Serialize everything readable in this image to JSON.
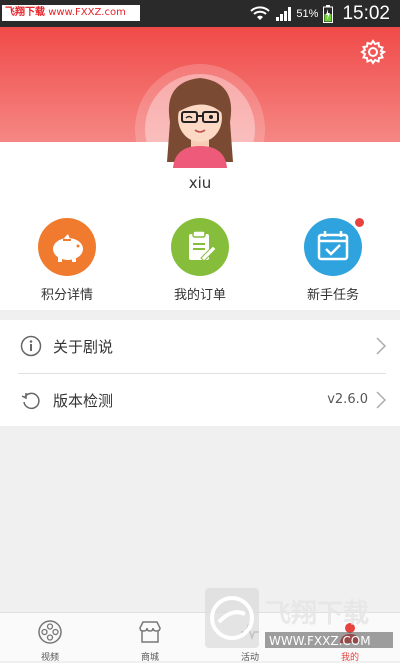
{
  "status_bar": {
    "watermark_left": "飞翔下载 www.FXXZ.com",
    "watermark_part1": "飞翔下载",
    "watermark_part2": "www.FXXZ.com",
    "battery": "51%",
    "time": "15:02",
    "icons": [
      "wifi-icon",
      "signal-icon",
      "battery-icon"
    ]
  },
  "header": {
    "settings_icon": "gear-icon",
    "username": "xiu"
  },
  "quick_actions": [
    {
      "label": "积分详情",
      "icon": "piggy-bank-icon",
      "color": "#f07a2e"
    },
    {
      "label": "我的订单",
      "icon": "order-ticket-icon",
      "color": "#86be3c"
    },
    {
      "label": "新手任务",
      "icon": "calendar-check-icon",
      "color": "#2ea3dd",
      "badge": true
    }
  ],
  "menu": [
    {
      "label": "关于剧说",
      "icon": "info-icon",
      "value": ""
    },
    {
      "label": "版本检测",
      "icon": "refresh-icon",
      "value": "v2.6.0"
    }
  ],
  "tabs": [
    {
      "label": "视频",
      "icon": "film-reel-icon"
    },
    {
      "label": "商城",
      "icon": "store-icon"
    },
    {
      "label": "活动",
      "icon": "activity-icon"
    },
    {
      "label": "我的",
      "icon": "user-icon",
      "active": true
    }
  ],
  "watermark_bottom": {
    "title": "飞翔下载",
    "url": "WWW.FXXZ.COM"
  },
  "colors": {
    "accent": "#e8423f",
    "header_top": "#f04a48",
    "header_bottom": "#f58784"
  }
}
